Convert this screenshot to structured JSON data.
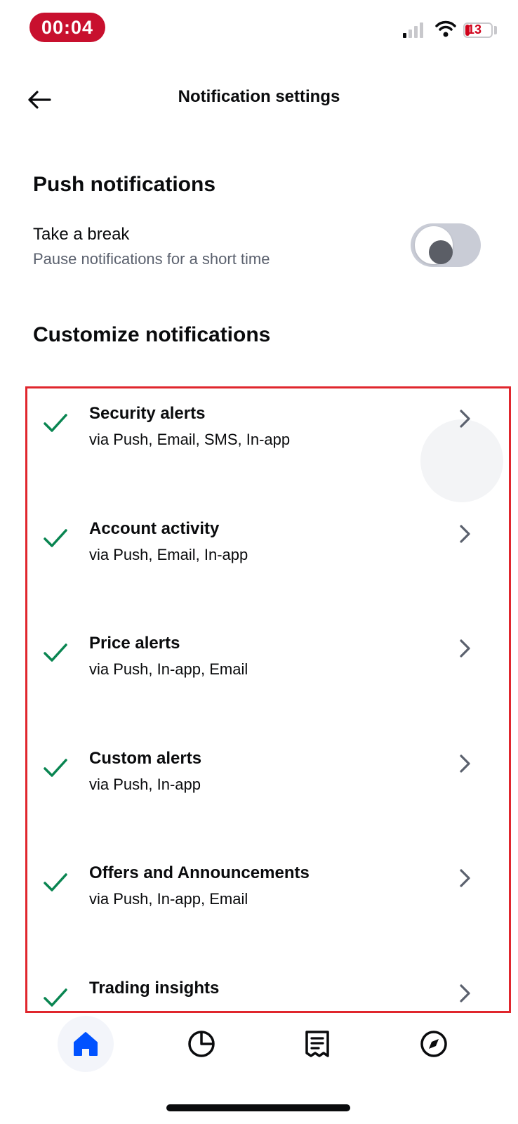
{
  "status_bar": {
    "time": "00:04",
    "battery_level": "13"
  },
  "header": {
    "title": "Notification settings"
  },
  "push": {
    "heading": "Push notifications",
    "take_break_title": "Take a break",
    "take_break_subtitle": "Pause notifications for a short time",
    "take_break_enabled": false
  },
  "customize": {
    "heading": "Customize notifications",
    "items": [
      {
        "title": "Security alerts",
        "channels": "via Push, Email, SMS, In-app",
        "checked": true
      },
      {
        "title": "Account activity",
        "channels": "via Push, Email, In-app",
        "checked": true
      },
      {
        "title": "Price alerts",
        "channels": "via Push, In-app, Email",
        "checked": true
      },
      {
        "title": "Custom alerts",
        "channels": "via Push, In-app",
        "checked": true
      },
      {
        "title": "Offers and Announcements",
        "channels": "via Push, In-app, Email",
        "checked": true
      },
      {
        "title": "Trading insights",
        "channels": "",
        "checked": true
      }
    ]
  },
  "colors": {
    "accent": "#0052ff",
    "check": "#098551",
    "highlight_border": "#e0262d",
    "time_pill": "#c8102e"
  },
  "bottom_nav": {
    "items": [
      {
        "icon": "home-icon",
        "active": true
      },
      {
        "icon": "portfolio-pie-icon",
        "active": false
      },
      {
        "icon": "orders-receipt-icon",
        "active": false
      },
      {
        "icon": "explore-compass-icon",
        "active": false
      }
    ]
  }
}
